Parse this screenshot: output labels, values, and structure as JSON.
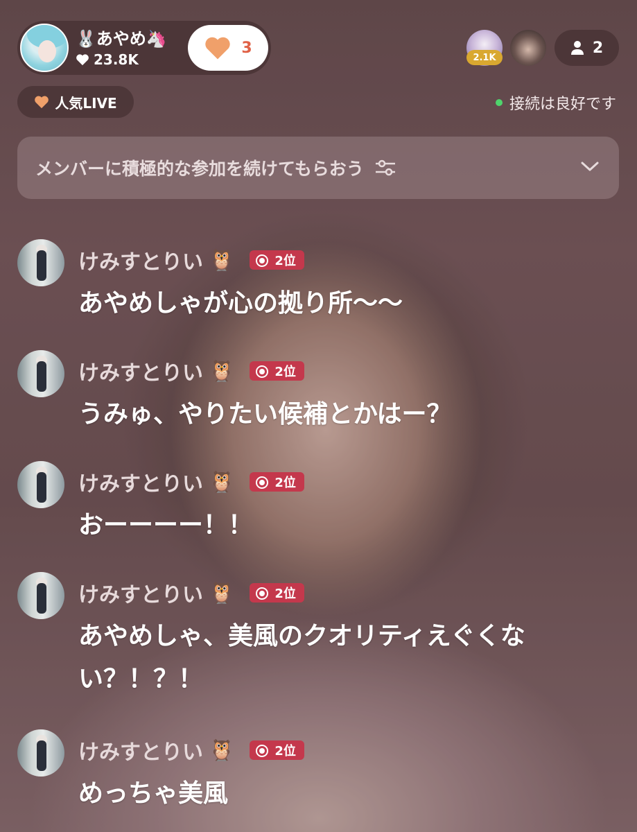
{
  "header": {
    "streamer": {
      "name": "あやめ",
      "name_prefix_emoji": "🐰",
      "name_suffix_emoji": "🦄",
      "likes": "23.8K",
      "heart_count": "3"
    },
    "viewers": [
      {
        "badge": "2.1K"
      },
      {
        "badge": ""
      }
    ],
    "viewer_count": "2"
  },
  "status": {
    "popular_label": "人気LIVE",
    "connection_text": "接続は良好です",
    "connection_color": "#4fd46c"
  },
  "prompt": {
    "text": "メンバーに積極的な参加を続けてもらおう"
  },
  "comments": [
    {
      "user": "けみすとりい",
      "user_emoji": "🦉",
      "rank": "2位",
      "text": "あやめしゃが心の拠り所〜〜"
    },
    {
      "user": "けみすとりい",
      "user_emoji": "🦉",
      "rank": "2位",
      "text": "うみゅ、やりたい候補とかはー？"
    },
    {
      "user": "けみすとりい",
      "user_emoji": "🦉",
      "rank": "2位",
      "text": "おーーーー！！"
    },
    {
      "user": "けみすとりい",
      "user_emoji": "🦉",
      "rank": "2位",
      "text": "あやめしゃ、美風のクオリティえぐくない？！？！"
    },
    {
      "user": "けみすとりい",
      "user_emoji": "🦉",
      "rank": "2位",
      "text": "めっちゃ美風"
    }
  ],
  "colors": {
    "rank_badge": "#c4384c",
    "heart_orange": "#f0a06a",
    "viewer_badge_gold": "#d9a830"
  }
}
